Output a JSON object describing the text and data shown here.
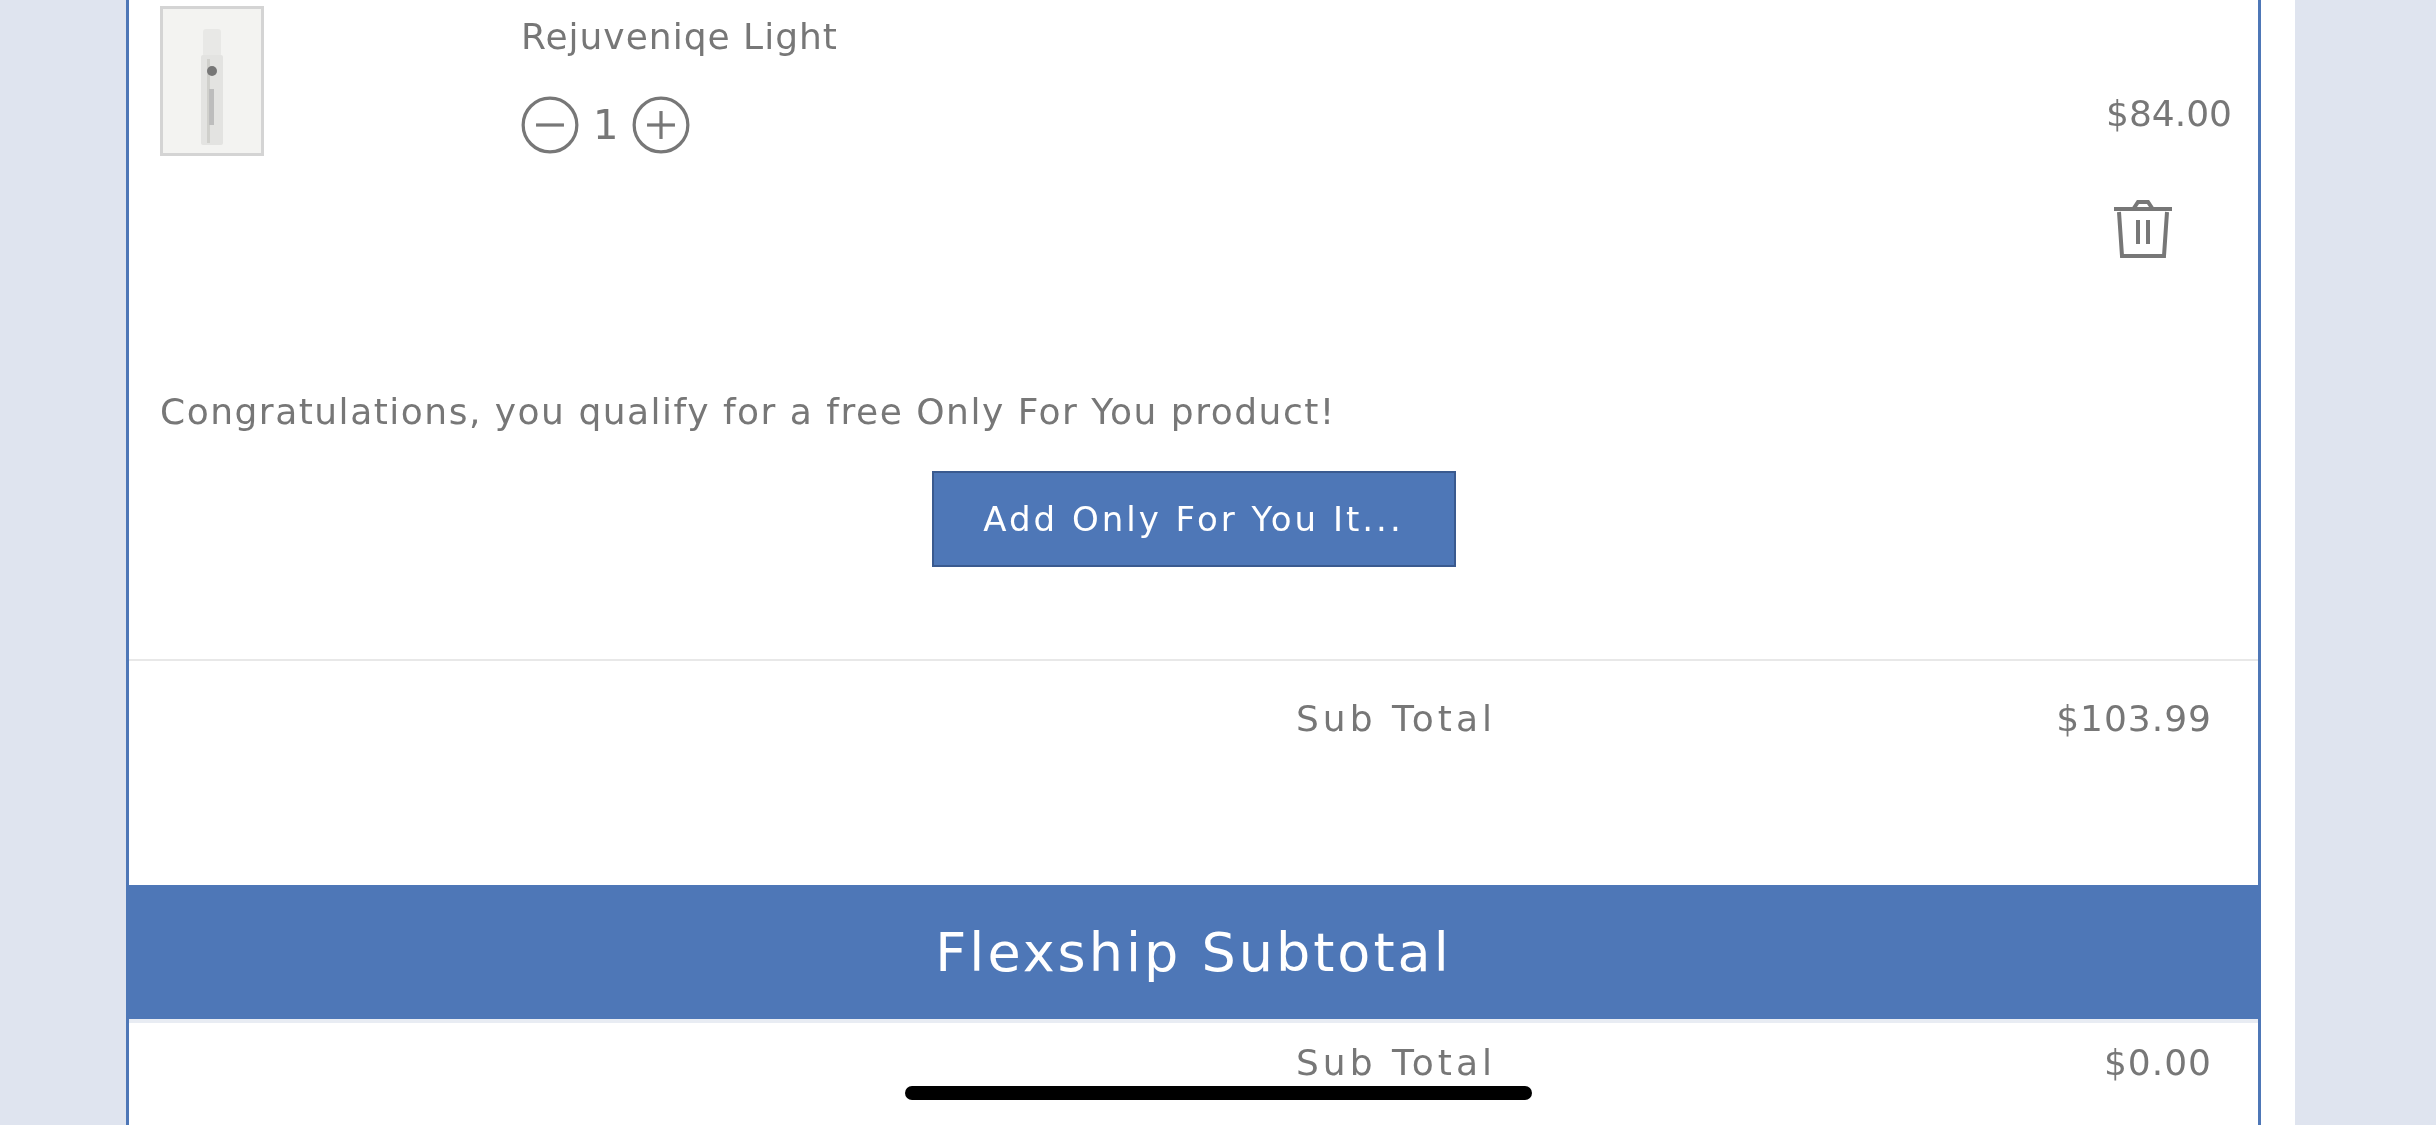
{
  "cart_item": {
    "kind": "picture",
    "name": "Rejuveniqe Light",
    "quantity": "1",
    "price": "$84.00"
  },
  "promo": {
    "message": "Congratulations, you qualify for a free Only For You product!",
    "button": "Add Only For You It..."
  },
  "order_subtotal": {
    "label": "Sub Total",
    "value": "$103.99"
  },
  "flexship": {
    "title": "Flexship Subtotal",
    "label": "Sub Total",
    "value": "$0.00"
  }
}
